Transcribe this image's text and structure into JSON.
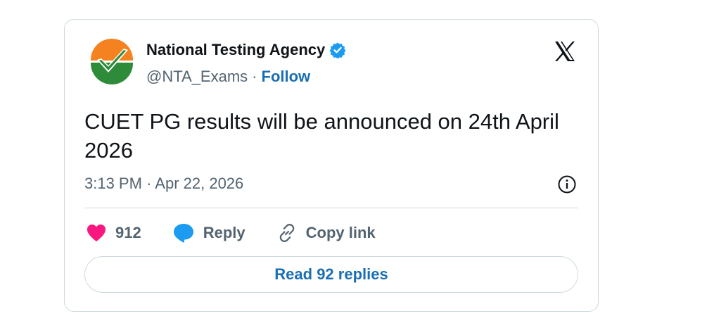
{
  "tweet": {
    "author_name": "National Testing Agency",
    "handle": "@NTA_Exams",
    "separator": "·",
    "follow_label": "Follow",
    "text": "CUET PG results will be announced on 24th April 2026",
    "time": "3:13 PM",
    "date": "Apr 22, 2026",
    "likes": "912",
    "reply_label": "Reply",
    "copy_link_label": "Copy link",
    "read_replies_label": "Read 92 replies"
  },
  "icons": {
    "avatar": "nta-logo-avatar",
    "verified": "verified-badge-icon",
    "platform": "x-logo-icon",
    "info": "info-icon",
    "like": "heart-icon",
    "reply": "speech-bubble-icon",
    "copy_link": "link-icon"
  },
  "colors": {
    "heart": "#f91880",
    "reply_bubble": "#1d9bf0",
    "verified": "#1d9bf0",
    "link_text": "#1a6fb3",
    "muted": "#536471"
  }
}
